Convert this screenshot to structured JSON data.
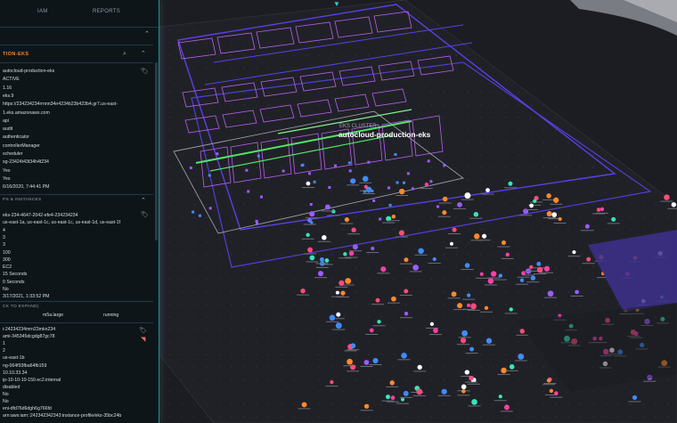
{
  "top_indicator": "▼",
  "tabs": {
    "left": "",
    "iam": "IAM",
    "reports": "REPORTS"
  },
  "section": {
    "title": "TION-EKS"
  },
  "cluster_fields": [
    "autocloud-production-eks",
    "ACTIVE",
    "1.16",
    "eks.9",
    "https://234234234rrnnn34n4234b23b423b4.gr7.us-east-",
    "1.eks.amazonaws.com",
    "api",
    "audit",
    "authenticator",
    "controllerManager",
    "scheduler",
    "sg-23424t43t34h4t234",
    "Yes",
    "Yes",
    "6/16/2020, 7:44:41 PM"
  ],
  "node_group_title": "PS & INSTANCES",
  "node_group_fields": [
    "eks-234-4647-2042-efe4-234234234",
    "us-east-1a, us-east-1c, us-east-1c, us-east-1d, us-east-1f",
    "4",
    "3",
    "3",
    "100",
    "300",
    "EC2",
    "15 Seconds",
    "0 Seconds",
    "No",
    "3/17/2021, 1:33:52 PM"
  ],
  "expand_hint": "CK TO EXPAND)",
  "instance_summary": {
    "type": "m5a.large",
    "state": "running"
  },
  "instance_fields": [
    "i-24234234mrn23mkn234",
    "ami-345345dcgdg87gc78",
    "1",
    "2",
    "us-east-1b",
    "ng-064f93fba64fb159",
    "10.10.33.34",
    "ip-10-10-10-150.ec2.internal",
    "disabled",
    "No",
    "No",
    "eni-dfd76d6dgh6g766fd",
    "arn:aws:iam::242342342343:instance-profile/eks-35bc24b"
  ],
  "diagram": {
    "cluster_caption": "EKS CLUSTER",
    "cluster_name": "autocloud-production-eks",
    "colors": {
      "background": "#1c1d22",
      "vpc": "#5a40e8",
      "subnet": "#b85ff0",
      "cluster_line": "#53e36a",
      "panel_border": "#2a8a8f",
      "accent": "#e88a3a"
    }
  }
}
